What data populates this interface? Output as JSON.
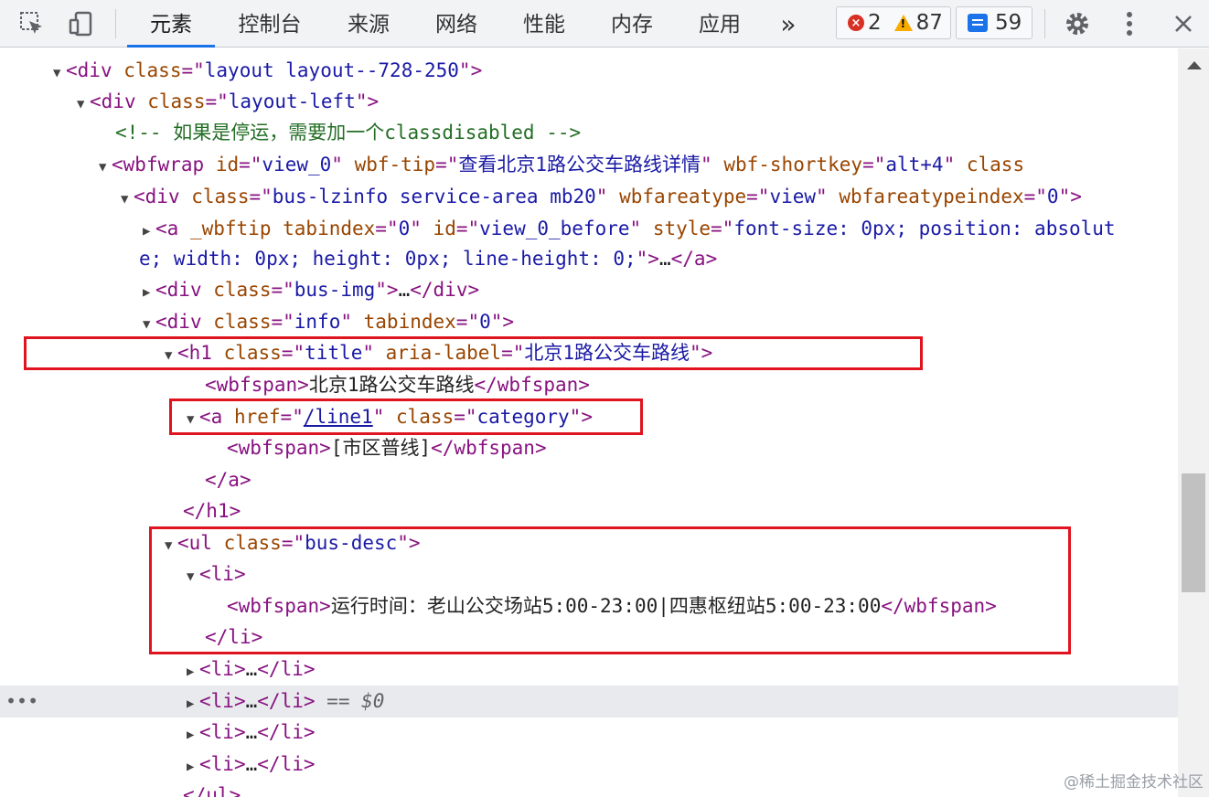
{
  "toolbar": {
    "tabs": [
      "元素",
      "控制台",
      "来源",
      "网络",
      "性能",
      "内存",
      "应用"
    ],
    "more_label": "»",
    "errors": "2",
    "warnings": "87",
    "messages": "59"
  },
  "tree": {
    "l1": {
      "tag": "div",
      "attr": "class",
      "val": "layout layout--728-250"
    },
    "l2": {
      "tag": "div",
      "attr": "class",
      "val": "layout-left"
    },
    "l3": {
      "comment": "<!-- 如果是停运，需要加一个classdisabled -->"
    },
    "l4": {
      "tag": "wbfwrap",
      "a1": "id",
      "v1": "view_0",
      "a2": "wbf-tip",
      "v2": "查看北京1路公交车路线详情",
      "a3": "wbf-shortkey",
      "v3": "alt+4",
      "a4": "class"
    },
    "l5": {
      "tag": "div",
      "a1": "class",
      "v1": "bus-lzinfo service-area mb20",
      "a2": "wbfareatype",
      "v2": "view",
      "a3": "wbfareatypeindex",
      "v3": "0"
    },
    "l6": {
      "tag": "a",
      "a0": "_wbftip",
      "a1": "tabindex",
      "v1": "0",
      "a2": "id",
      "v2": "view_0_before",
      "a3": "style",
      "v3a": "font-size: 0px; position: absolut",
      "v3b": "e; width: 0px; height: 0px; line-height: 0;",
      "close": "a"
    },
    "l7": {
      "tag": "div",
      "attr": "class",
      "val": "bus-img",
      "close": "div"
    },
    "l8": {
      "tag": "div",
      "a1": "class",
      "v1": "info",
      "a2": "tabindex",
      "v2": "0"
    },
    "l9": {
      "tag": "h1",
      "a1": "class",
      "v1": "title",
      "a2": "aria-label",
      "v2": "北京1路公交车路线"
    },
    "l10": {
      "tag": "wbfspan",
      "text": "北京1路公交车路线"
    },
    "l11": {
      "tag": "a",
      "a1": "href",
      "v1": "/line1",
      "a2": "class",
      "v2": "category"
    },
    "l12": {
      "tag": "wbfspan",
      "text": "[市区普线]"
    },
    "l13": {
      "close": "a"
    },
    "l14": {
      "close": "h1"
    },
    "l15": {
      "tag": "ul",
      "attr": "class",
      "val": "bus-desc"
    },
    "l16": {
      "tag": "li"
    },
    "l17": {
      "tag": "wbfspan",
      "text": "运行时间：老山公交场站5:00-23:00|四惠枢纽站5:00-23:00"
    },
    "l18": {
      "close": "li"
    },
    "l19": {
      "tag": "li"
    },
    "l20": {
      "tag": "li",
      "selected": "== $0"
    },
    "l21": {
      "tag": "li"
    },
    "l22": {
      "tag": "li"
    },
    "l23": {
      "close": "ul"
    },
    "ellipsis": "…",
    "row_dots": "•••"
  },
  "watermark": "@稀土掘金技术社区"
}
